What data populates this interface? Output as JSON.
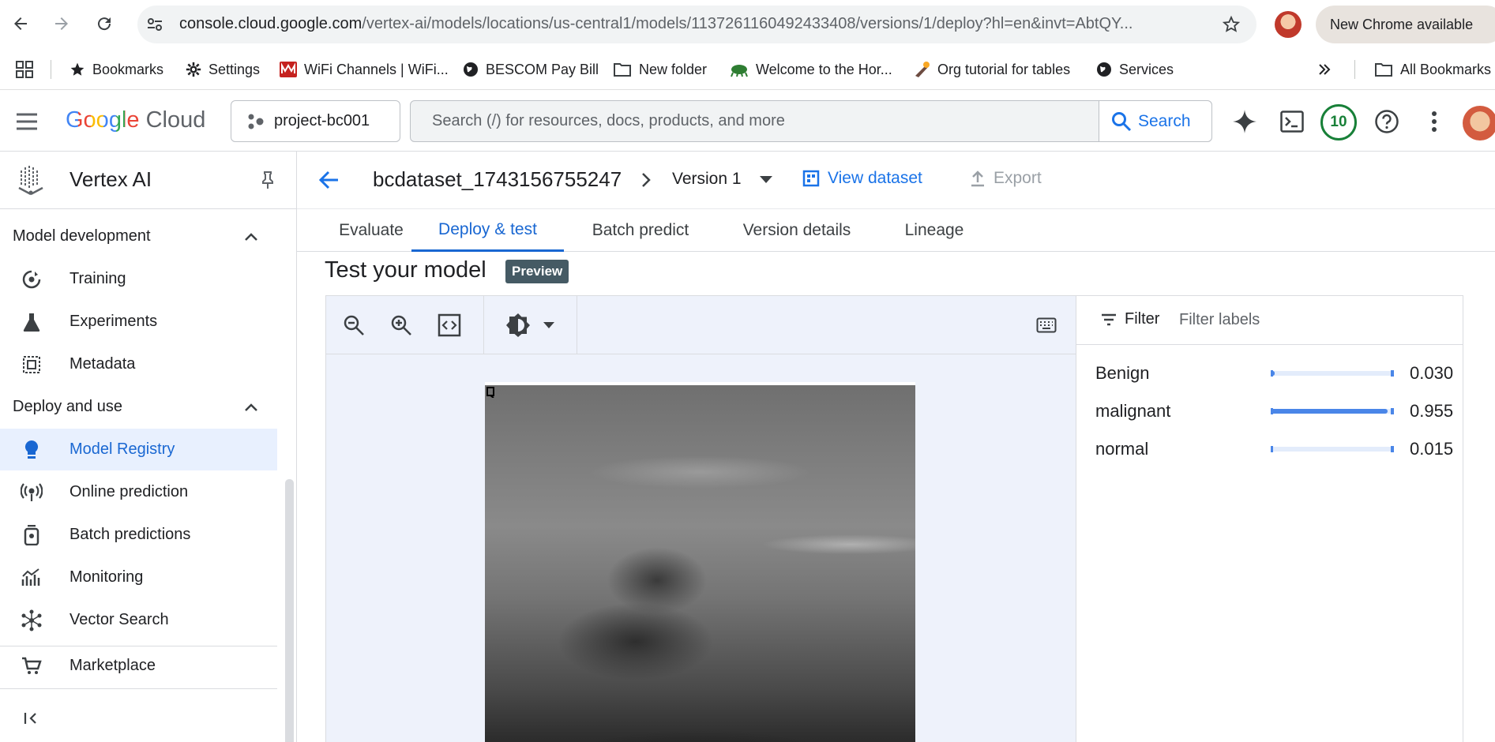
{
  "browser": {
    "url_host": "console.cloud.google.com",
    "url_path": "/vertex-ai/models/locations/us-central1/models/1137261160492433408/versions/1/deploy?hl=en&invt=AbtQY...",
    "new_chrome": "New Chrome available"
  },
  "bookmarks": [
    {
      "label": "Bookmarks",
      "icon": "star-icon"
    },
    {
      "label": "Settings",
      "icon": "gear-icon"
    },
    {
      "label": "WiFi Channels | WiFi...",
      "icon": "wifi-site-icon"
    },
    {
      "label": "BESCOM Pay Bill",
      "icon": "globe-icon"
    },
    {
      "label": "New folder",
      "icon": "folder-icon"
    },
    {
      "label": "Welcome to the Hor...",
      "icon": "site-icon"
    },
    {
      "label": "Org tutorial for tables",
      "icon": "site-icon"
    },
    {
      "label": "Services",
      "icon": "globe-icon"
    }
  ],
  "all_bookmarks": "All Bookmarks",
  "header": {
    "logo_google": "Google",
    "logo_cloud": "Cloud",
    "project": "project-bc001",
    "search_placeholder": "Search (/) for resources, docs, products, and more",
    "search_button": "Search",
    "notifications": "10"
  },
  "sidebar": {
    "title": "Vertex AI",
    "sections": [
      {
        "title": "Model development",
        "items": [
          "Training",
          "Experiments",
          "Metadata"
        ]
      },
      {
        "title": "Deploy and use",
        "items": [
          "Model Registry",
          "Online prediction",
          "Batch predictions",
          "Monitoring",
          "Vector Search"
        ]
      }
    ],
    "marketplace": "Marketplace",
    "active": "Model Registry"
  },
  "page": {
    "dataset": "bcdataset_1743156755247",
    "version": "Version 1",
    "view_dataset": "View dataset",
    "export": "Export",
    "tabs": [
      "Evaluate",
      "Deploy & test",
      "Batch predict",
      "Version details",
      "Lineage"
    ],
    "active_tab": "Deploy & test",
    "test_title": "Test your model",
    "badge": "Preview"
  },
  "results": {
    "filter_label": "Filter",
    "filter_placeholder": "Filter labels",
    "predictions": [
      {
        "label": "Benign",
        "value": "0.030",
        "score": 0.03
      },
      {
        "label": "malignant",
        "value": "0.955",
        "score": 0.955
      },
      {
        "label": "normal",
        "value": "0.015",
        "score": 0.015
      }
    ]
  },
  "colors": {
    "accent": "#1a73e8",
    "active_bg": "#e8f0fe",
    "bar": "#4a86e8"
  }
}
